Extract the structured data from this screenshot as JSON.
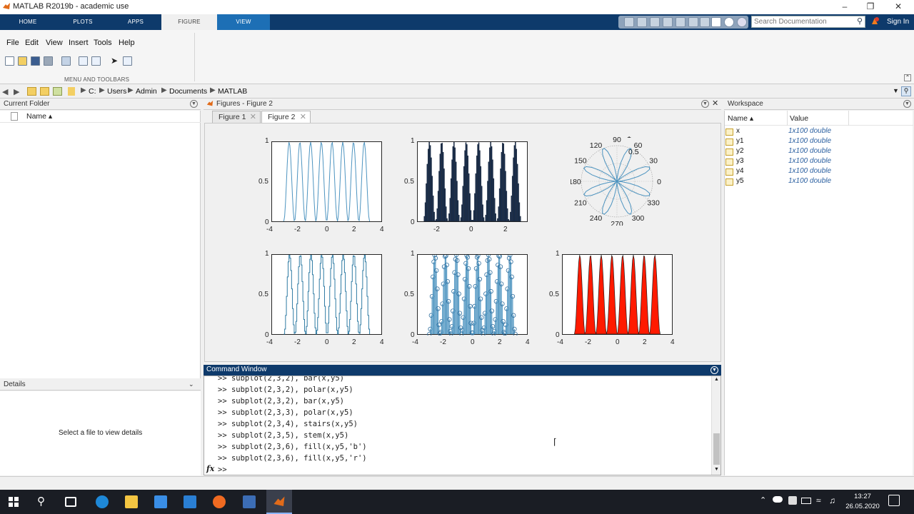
{
  "window": {
    "title": "MATLAB R2019b - academic use"
  },
  "ribbon_tabs": [
    "HOME",
    "PLOTS",
    "APPS",
    "FIGURE",
    "VIEW"
  ],
  "search": {
    "placeholder": "Search Documentation"
  },
  "signin": "Sign In",
  "menu": [
    "File",
    "Edit",
    "View",
    "Insert",
    "Tools",
    "Help"
  ],
  "ribbon_caption": "MENU AND TOOLBARS",
  "path": [
    "C:",
    "Users",
    "Admin",
    "Documents",
    "MATLAB"
  ],
  "current_folder": {
    "title": "Current Folder",
    "name_col": "Name ▴"
  },
  "details": {
    "title": "Details",
    "placeholder": "Select a file to view details"
  },
  "figures": {
    "title": "Figures - Figure 2",
    "tabs": [
      "Figure 1",
      "Figure 2"
    ]
  },
  "workspace": {
    "title": "Workspace",
    "columns": [
      "Name ▴",
      "Value"
    ],
    "rows": [
      {
        "name": "x",
        "value": "1x100 double"
      },
      {
        "name": "y1",
        "value": "1x100 double"
      },
      {
        "name": "y2",
        "value": "1x100 double"
      },
      {
        "name": "y3",
        "value": "1x100 double"
      },
      {
        "name": "y4",
        "value": "1x100 double"
      },
      {
        "name": "y5",
        "value": "1x100 double"
      }
    ]
  },
  "command_window": {
    "title": "Command Window",
    "lines": [
      ">> subplot(2,3,2), bar(x,y5)",
      ">> subplot(2,3,2), polar(x,y5)",
      ">> subplot(2,3,2), bar(x,y5)",
      ">> subplot(2,3,3), polar(x,y5)",
      ">> subplot(2,3,4), stairs(x,y5)",
      ">> subplot(2,3,5), stem(x,y5)",
      ">> subplot(2,3,6), fill(x,y5,'b')",
      ">> subplot(2,3,6), fill(x,y5,'r')"
    ],
    "prompt": ">>",
    "fx": "fx"
  },
  "taskbar": {
    "time": "13:27",
    "date": "26.05.2020"
  },
  "colors": {
    "matlab_blue": "#0e3a6b",
    "view_tab": "#1d6fb5",
    "plot_line": "#4d94c0",
    "bar_fill": "#1c3354",
    "fill_red": "#ff1a00"
  },
  "chart_data": [
    {
      "type": "line",
      "subplot": 1,
      "x_ticks": [
        "-4",
        "-2",
        "0",
        "2",
        "4"
      ],
      "y_ticks": [
        "0",
        "0.5",
        "1"
      ],
      "xlim": [
        -4,
        4
      ],
      "ylim": [
        0,
        1
      ],
      "series": [
        {
          "function": "sin(4x)^2 sampled at 100 points over [-pi, pi]",
          "peaks": 8
        }
      ]
    },
    {
      "type": "bar",
      "subplot": 2,
      "x_ticks": [
        "-2",
        "0",
        "2"
      ],
      "y_ticks": [
        "0",
        "0.5",
        "1"
      ],
      "ylim": [
        0,
        1
      ],
      "series": [
        {
          "function": "y5 bars, 100 points over [-pi, pi]",
          "peaks": 8
        }
      ]
    },
    {
      "type": "polar",
      "subplot": 3,
      "angle_labels": [
        "90",
        "60",
        "30",
        "0",
        "330",
        "300",
        "270",
        "240",
        "210",
        "180",
        "150",
        "120"
      ],
      "radius_labels": [
        "0.5",
        "1"
      ],
      "petals": 8
    },
    {
      "type": "stairs",
      "subplot": 4,
      "x_ticks": [
        "-4",
        "-2",
        "0",
        "2",
        "4"
      ],
      "y_ticks": [
        "0",
        "0.5",
        "1"
      ],
      "xlim": [
        -4,
        4
      ],
      "ylim": [
        0,
        1
      ]
    },
    {
      "type": "stem",
      "subplot": 5,
      "x_ticks": [
        "-4",
        "-2",
        "0",
        "2",
        "4"
      ],
      "y_ticks": [
        "0",
        "0.5",
        "1"
      ],
      "xlim": [
        -4,
        4
      ],
      "ylim": [
        0,
        1
      ]
    },
    {
      "type": "area",
      "subplot": 6,
      "x_ticks": [
        "-4",
        "-2",
        "0",
        "2",
        "4"
      ],
      "y_ticks": [
        "0",
        "0.5",
        "1"
      ],
      "xlim": [
        -4,
        4
      ],
      "ylim": [
        0,
        1
      ],
      "fill": "r"
    }
  ]
}
